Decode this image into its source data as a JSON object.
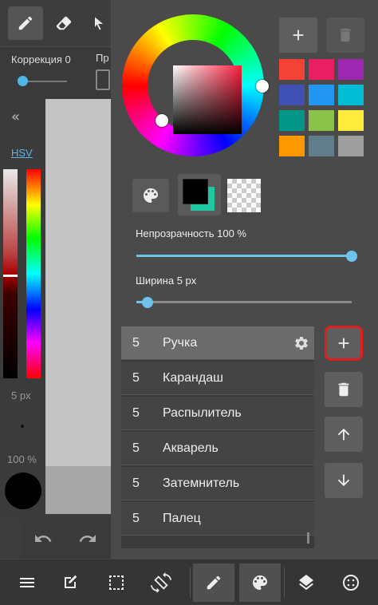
{
  "left_panel": {
    "correction_label": "Коррекция 0",
    "pr_label": "Пр",
    "hsv_link": "HSV",
    "brush_size": "5 px",
    "opacity_pct": "100 %"
  },
  "color_popup": {
    "swatches": [
      "#f44336",
      "#e91e63",
      "#9c27b0",
      "#3f51b5",
      "#2196f3",
      "#00bcd4",
      "#009688",
      "#8bc34a",
      "#ffeb3b",
      "#ff9800",
      "#607d8b",
      "#9e9e9e"
    ],
    "foreground_color": "#000000",
    "background_color": "#1fc7a0",
    "opacity_label": "Непрозрачность 100 %",
    "opacity_value": 1.0,
    "width_label": "Ширина 5 px",
    "width_value": 0.05
  },
  "brushes": [
    {
      "size": "5",
      "name": "Ручка",
      "selected": true
    },
    {
      "size": "5",
      "name": "Карандаш",
      "selected": false
    },
    {
      "size": "5",
      "name": "Распылитель",
      "selected": false
    },
    {
      "size": "5",
      "name": "Акварель",
      "selected": false
    },
    {
      "size": "5",
      "name": "Затемнитель",
      "selected": false
    },
    {
      "size": "5",
      "name": "Палец",
      "selected": false
    }
  ],
  "icons": {
    "top_tools": [
      "pencil-icon",
      "eraser-icon",
      "select-icon"
    ],
    "bottom_bar": [
      "menu-icon",
      "edit-icon",
      "selection-icon",
      "rotate-icon",
      "brush-icon",
      "palette-icon",
      "layers-icon",
      "more-icon"
    ]
  }
}
